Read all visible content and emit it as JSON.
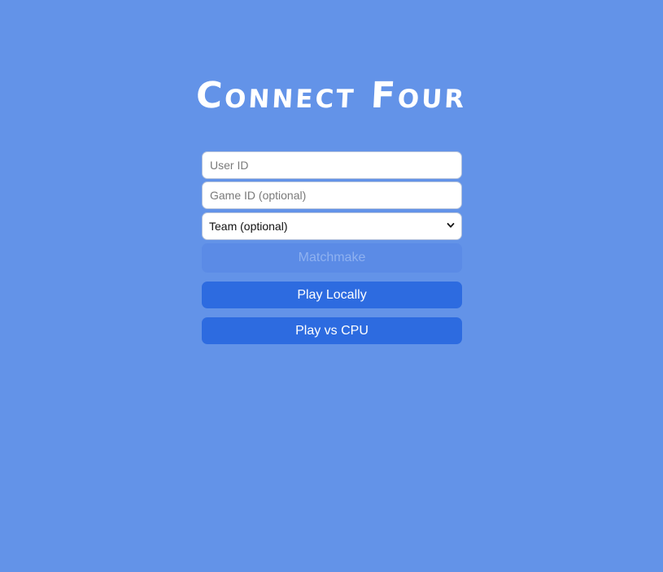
{
  "title": "Connect Four",
  "form": {
    "user_id_placeholder": "User ID",
    "game_id_placeholder": "Game ID (optional)",
    "team_selected": "Team (optional)"
  },
  "buttons": {
    "matchmake": "Matchmake",
    "play_locally": "Play Locally",
    "play_vs_cpu": "Play vs CPU"
  },
  "colors": {
    "background": "#6393e8",
    "button": "#2d6be0",
    "button_disabled": "#5b8be6"
  }
}
